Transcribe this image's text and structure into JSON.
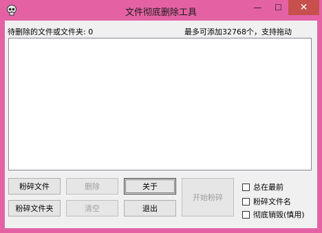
{
  "window": {
    "title": "文件彻底删除工具",
    "icon": "skull-icon",
    "minimize_symbol": "—",
    "maximize_symbol": "☐",
    "close_symbol": "✕",
    "colors": {
      "frame": "#e462a4",
      "close": "#c7504f",
      "client": "#f0f0f0"
    }
  },
  "status": {
    "count_label": "待删除的文件或文件夹: 0",
    "limit_label": "最多可添加32768个，支持拖动"
  },
  "buttons": {
    "shred_file": "粉碎文件",
    "shred_folder": "粉碎文件夹",
    "delete": "删除",
    "clear": "清空",
    "about": "关于",
    "exit": "退出",
    "start": "开始粉碎"
  },
  "options": [
    {
      "label": "总在最前",
      "checked": false
    },
    {
      "label": "粉碎文件名",
      "checked": false
    },
    {
      "label": "彻底销毁(慎用)",
      "checked": false
    }
  ]
}
